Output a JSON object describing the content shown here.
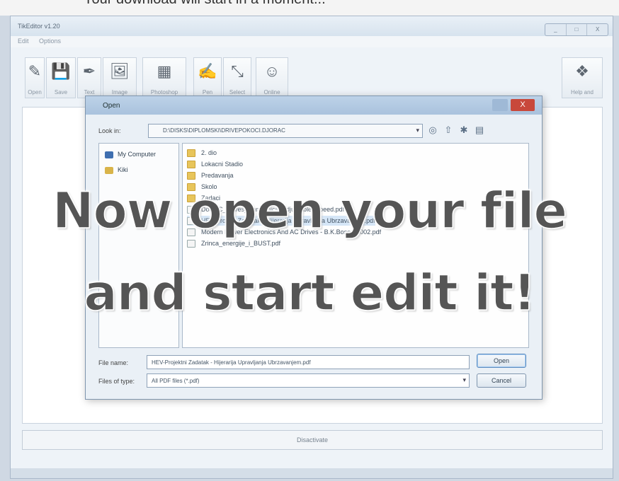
{
  "caption_top": "Your download will start in a moment...",
  "app": {
    "title": "TikEditor v1.20",
    "menu": [
      "Edit",
      "Options"
    ],
    "window_controls": [
      "_",
      "□",
      "X"
    ],
    "toolbar": [
      {
        "label": "Open",
        "icon": "pen-doc-icon",
        "glyph": "✎"
      },
      {
        "label": "Save",
        "icon": "floppy-disk-icon",
        "glyph": "💾"
      },
      {
        "label": "Text",
        "icon": "text-tool-icon",
        "glyph": "✒"
      },
      {
        "label": "Image",
        "icon": "image-icon",
        "glyph": "🖼"
      },
      {
        "label": "Photoshop",
        "icon": "photoshop-icon",
        "glyph": "▦"
      },
      {
        "label": "Pen",
        "icon": "pen-icon",
        "glyph": "✍"
      },
      {
        "label": "Select",
        "icon": "select-icon",
        "glyph": "⤡"
      },
      {
        "label": "Online",
        "icon": "face-icon",
        "glyph": "☺"
      }
    ],
    "help_button": {
      "label": "Help and",
      "icon": "help-icon",
      "glyph": "❖"
    },
    "status_text": "Disactivate"
  },
  "dialog": {
    "title": "Open",
    "close_glyph": "X",
    "look_in_label": "Look in:",
    "look_in_path": "D:\\DISKS\\DIPLOMSKI\\DRIVEPOKOCI.DJORAC",
    "nav_icons": [
      "back-icon",
      "up-folder-icon",
      "new-folder-icon",
      "views-icon"
    ],
    "nav_glyphs": [
      "◎",
      "⇧",
      "✱",
      "▤"
    ],
    "places": [
      {
        "label": "My Computer",
        "icon": "computer-icon"
      },
      {
        "label": "Kiki",
        "icon": "user-folder-icon"
      }
    ],
    "files": [
      {
        "name": "2. dio",
        "type": "folder"
      },
      {
        "name": "Lokacni Stadio",
        "type": "folder"
      },
      {
        "name": "Predavanja",
        "type": "folder"
      },
      {
        "name": "Skolo",
        "type": "folder"
      },
      {
        "name": "Zadaci",
        "type": "folder"
      },
      {
        "name": "Doc AC_Drives_Harmonics_Adjustable_Speed.pdf",
        "type": "pdf"
      },
      {
        "name": "HEV Projekt Zadatak - Hijerarija Upravljanja Ubrzavanjem.pdf",
        "type": "pdf",
        "selected": true
      },
      {
        "name": "Modern Power Electronics And AC Drives - B.K.Bose - 2002.pdf",
        "type": "pdf"
      },
      {
        "name": "Zrinca_energije_i_BUST.pdf",
        "type": "pdf"
      }
    ],
    "file_name_label": "File name:",
    "file_name_value": "HEV-Projektni Zadatak - Hijerarija Upravljanja Ubrzavanjem.pdf",
    "file_type_label": "Files of type:",
    "file_type_value": "All PDF files (*.pdf)",
    "open_button": "Open",
    "cancel_button": "Cancel"
  },
  "overlay": {
    "line1": "Now open your file",
    "line2": "and start edit it!"
  }
}
